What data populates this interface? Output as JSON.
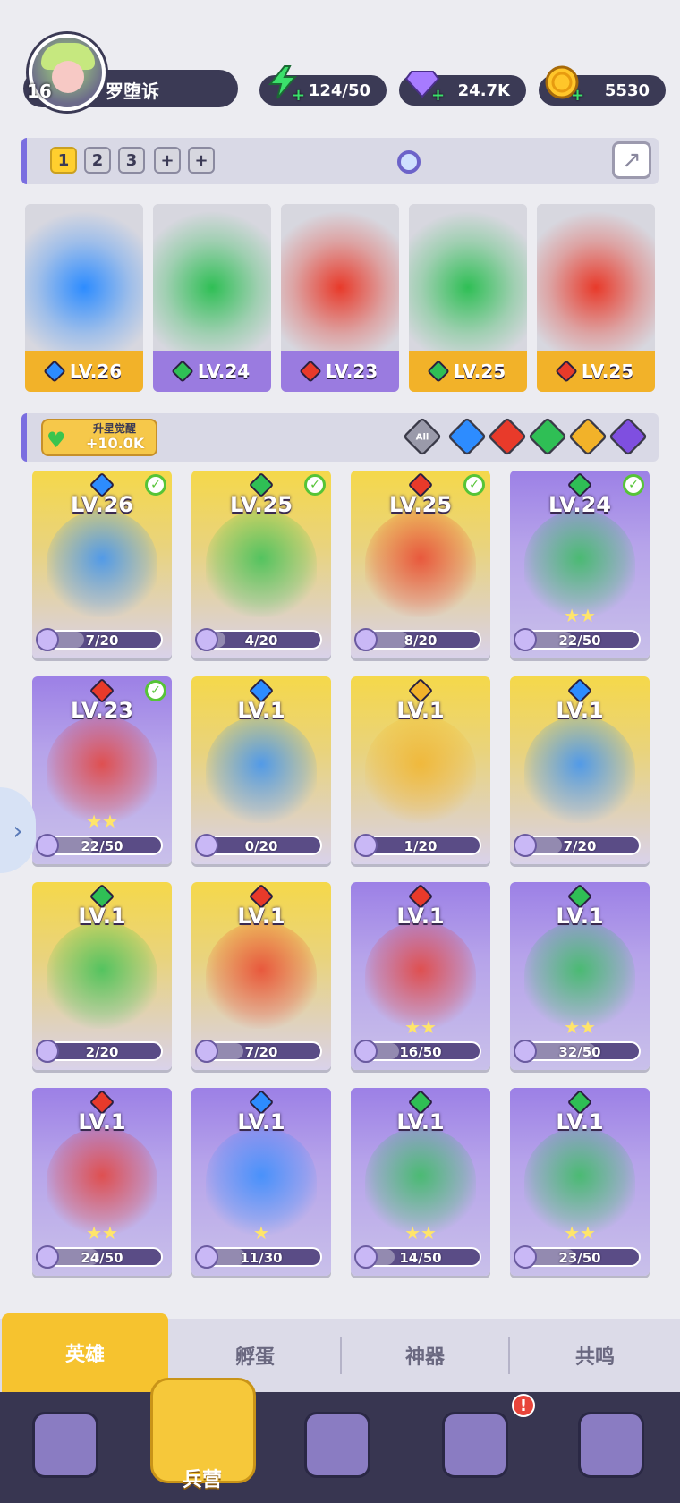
{
  "player": {
    "level": "16",
    "name": "罗堕诉"
  },
  "resources": {
    "energy": "124/50",
    "gems": "24.7K",
    "coins": "5530"
  },
  "teams": {
    "tabs": [
      "1",
      "2",
      "3",
      "+",
      "+"
    ],
    "active": "1"
  },
  "team_slots": [
    {
      "level": "LV.26",
      "element": "water",
      "color": "gold"
    },
    {
      "level": "LV.24",
      "element": "wind",
      "color": "purple"
    },
    {
      "level": "LV.23",
      "element": "fire",
      "color": "purple"
    },
    {
      "level": "LV.25",
      "element": "wind",
      "color": "gold"
    },
    {
      "level": "LV.25",
      "element": "fire",
      "color": "gold"
    }
  ],
  "awaken": {
    "title": "升星觉醒",
    "value": "+10.0K"
  },
  "filters": [
    {
      "label": "All",
      "element": "all"
    },
    {
      "label": "",
      "element": "water"
    },
    {
      "label": "",
      "element": "fire"
    },
    {
      "label": "",
      "element": "wind"
    },
    {
      "label": "",
      "element": "light"
    },
    {
      "label": "",
      "element": "dark"
    }
  ],
  "heroes": [
    {
      "level": "LV.26",
      "element": "water",
      "color": "gold",
      "progress": "7/20",
      "fraction": 0.35,
      "checked": true,
      "stars": ""
    },
    {
      "level": "LV.25",
      "element": "wind",
      "color": "gold",
      "progress": "4/20",
      "fraction": 0.2,
      "checked": true,
      "stars": ""
    },
    {
      "level": "LV.25",
      "element": "fire",
      "color": "gold",
      "progress": "8/20",
      "fraction": 0.4,
      "checked": true,
      "stars": ""
    },
    {
      "level": "LV.24",
      "element": "wind",
      "color": "purple",
      "progress": "22/50",
      "fraction": 0.44,
      "checked": true,
      "stars": "★★"
    },
    {
      "level": "LV.23",
      "element": "fire",
      "color": "purple",
      "progress": "22/50",
      "fraction": 0.44,
      "checked": true,
      "stars": "★★"
    },
    {
      "level": "LV.1",
      "element": "water",
      "color": "gold",
      "progress": "0/20",
      "fraction": 0,
      "checked": false,
      "stars": ""
    },
    {
      "level": "LV.1",
      "element": "light",
      "color": "gold",
      "progress": "1/20",
      "fraction": 0.05,
      "checked": false,
      "stars": ""
    },
    {
      "level": "LV.1",
      "element": "water",
      "color": "gold",
      "progress": "7/20",
      "fraction": 0.35,
      "checked": false,
      "stars": ""
    },
    {
      "level": "LV.1",
      "element": "wind",
      "color": "gold",
      "progress": "2/20",
      "fraction": 0.1,
      "checked": false,
      "stars": ""
    },
    {
      "level": "LV.1",
      "element": "fire",
      "color": "gold",
      "progress": "7/20",
      "fraction": 0.35,
      "checked": false,
      "stars": ""
    },
    {
      "level": "LV.1",
      "element": "fire",
      "color": "purple",
      "progress": "16/50",
      "fraction": 0.32,
      "checked": false,
      "stars": "★★"
    },
    {
      "level": "LV.1",
      "element": "wind",
      "color": "purple",
      "progress": "32/50",
      "fraction": 0.64,
      "checked": false,
      "stars": "★★"
    },
    {
      "level": "LV.1",
      "element": "fire",
      "color": "purple",
      "progress": "24/50",
      "fraction": 0.48,
      "checked": false,
      "stars": "★★"
    },
    {
      "level": "LV.1",
      "element": "water",
      "color": "purple",
      "progress": "11/30",
      "fraction": 0.37,
      "checked": false,
      "stars": "★"
    },
    {
      "level": "LV.1",
      "element": "wind",
      "color": "purple",
      "progress": "14/50",
      "fraction": 0.28,
      "checked": false,
      "stars": "★★"
    },
    {
      "level": "LV.1",
      "element": "wind",
      "color": "purple",
      "progress": "23/50",
      "fraction": 0.46,
      "checked": false,
      "stars": "★★"
    }
  ],
  "sub_tabs": [
    "英雄",
    "孵蛋",
    "神器",
    "共鸣"
  ],
  "nav": {
    "active_label": "兵营",
    "alert": "!",
    "icons": [
      "cards-icon",
      "barracks-icon",
      "map-book-icon",
      "shop-icon",
      "mushroom-icon"
    ]
  },
  "colors": {
    "gold": "#f2b229",
    "purple": "#9a7be0",
    "water": "#2d8cff",
    "fire": "#e83a2a",
    "wind": "#2fbf55",
    "light": "#f2b229",
    "dark": "#7f4fe0"
  }
}
